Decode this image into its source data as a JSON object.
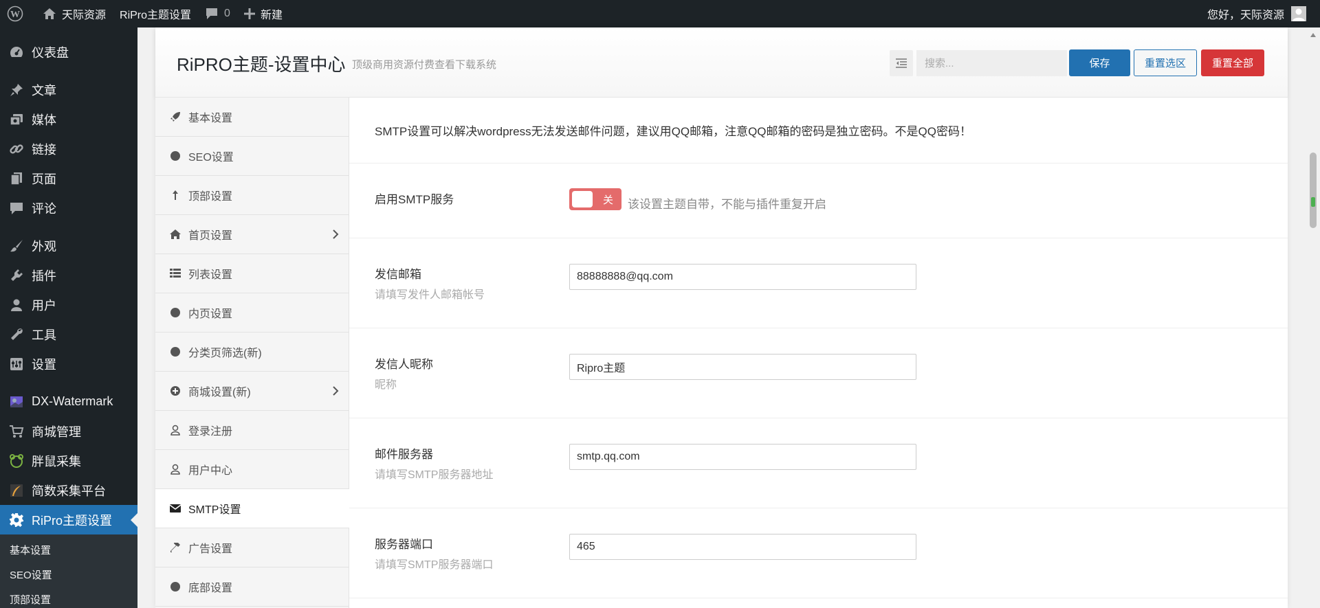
{
  "admin_bar": {
    "site_name": "天际资源",
    "theme_settings": "RiPro主题设置",
    "comments_count": "0",
    "new_label": "新建",
    "greeting": "您好，天际资源"
  },
  "admin_menu": {
    "items": [
      {
        "label": "仪表盘",
        "icon": "dashboard-icon"
      },
      {
        "label": "文章",
        "icon": "pin-icon"
      },
      {
        "label": "媒体",
        "icon": "media-icon"
      },
      {
        "label": "链接",
        "icon": "link-icon"
      },
      {
        "label": "页面",
        "icon": "page-icon"
      },
      {
        "label": "评论",
        "icon": "comment-icon"
      },
      {
        "label": "外观",
        "icon": "brush-icon"
      },
      {
        "label": "插件",
        "icon": "plugin-icon"
      },
      {
        "label": "用户",
        "icon": "user-icon"
      },
      {
        "label": "工具",
        "icon": "wrench-icon"
      },
      {
        "label": "设置",
        "icon": "settings-icon"
      },
      {
        "label": "DX-Watermark",
        "icon": "image-icon"
      },
      {
        "label": "商城管理",
        "icon": "cart-icon"
      },
      {
        "label": "胖鼠采集",
        "icon": "mouse-icon"
      },
      {
        "label": "简数采集平台",
        "icon": "feather-icon"
      },
      {
        "label": "RiPro主题设置",
        "icon": "gear-icon"
      }
    ],
    "submenu": [
      "基本设置",
      "SEO设置",
      "顶部设置"
    ]
  },
  "panel": {
    "title": "RiPRO主题-设置中心",
    "subtitle": "顶级商用资源付费查看下载系统",
    "search_placeholder": "搜索...",
    "save_label": "保存",
    "reset_section_label": "重置选区",
    "reset_all_label": "重置全部"
  },
  "section_nav": [
    {
      "label": "基本设置",
      "icon": "rocket-icon"
    },
    {
      "label": "SEO设置",
      "icon": "circle-icon"
    },
    {
      "label": "顶部设置",
      "icon": "arrow-up-icon"
    },
    {
      "label": "首页设置",
      "icon": "home-icon"
    },
    {
      "label": "列表设置",
      "icon": "list-icon"
    },
    {
      "label": "内页设置",
      "icon": "circle-icon"
    },
    {
      "label": "分类页筛选(新)",
      "icon": "circle-icon"
    },
    {
      "label": "商城设置(新)",
      "icon": "plus-circle-icon"
    },
    {
      "label": "登录注册",
      "icon": "user-outline-icon"
    },
    {
      "label": "用户中心",
      "icon": "user-outline-icon"
    },
    {
      "label": "SMTP设置",
      "icon": "envelope-icon"
    },
    {
      "label": "广告设置",
      "icon": "hammer-icon"
    },
    {
      "label": "底部设置",
      "icon": "circle-icon"
    }
  ],
  "content": {
    "notice": "SMTP设置可以解决wordpress无法发送邮件问题，建议用QQ邮箱，注意QQ邮箱的密码是独立密码。不是QQ密码！",
    "smtp_enable": {
      "title": "启用SMTP服务",
      "switch_label": "关",
      "switch_on": false,
      "help": "该设置主题自带，不能与插件重复开启"
    },
    "fields": [
      {
        "title": "发信邮箱",
        "desc": "请填写发件人邮箱帐号",
        "value": "88888888@qq.com"
      },
      {
        "title": "发信人昵称",
        "desc": "昵称",
        "value": "Ripro主题"
      },
      {
        "title": "邮件服务器",
        "desc": "请填写SMTP服务器地址",
        "value": "smtp.qq.com"
      },
      {
        "title": "服务器端口",
        "desc": "请填写SMTP服务器端口",
        "value": "465"
      }
    ]
  }
}
